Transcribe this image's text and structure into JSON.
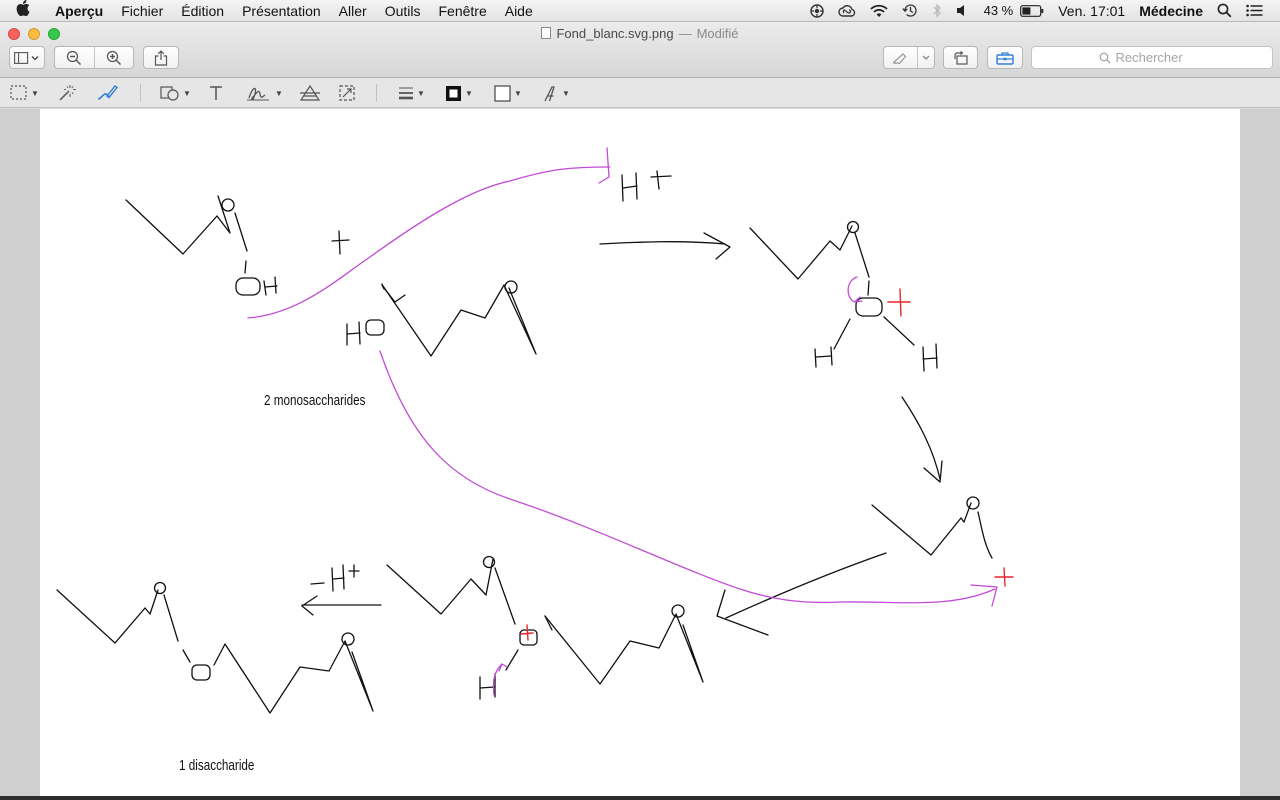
{
  "menubar": {
    "app_name": "Aperçu",
    "items": [
      "Fichier",
      "Édition",
      "Présentation",
      "Aller",
      "Outils",
      "Fenêtre",
      "Aide"
    ],
    "battery": "43 %",
    "clock": "Ven. 17:01",
    "user": "Médecine"
  },
  "window": {
    "file_name": "Fond_blanc.svg.png",
    "separator": "—",
    "status": "Modifié",
    "search_placeholder": "Rechercher"
  },
  "drawing": {
    "label_monosaccharides": "2 monosaccharides",
    "label_disaccharide": "1 disaccharide"
  },
  "colors": {
    "ink_black": "#111111",
    "ink_purple": "#c14bd6",
    "ink_red": "#e8262b",
    "accent_blue": "#2f7fd8"
  }
}
